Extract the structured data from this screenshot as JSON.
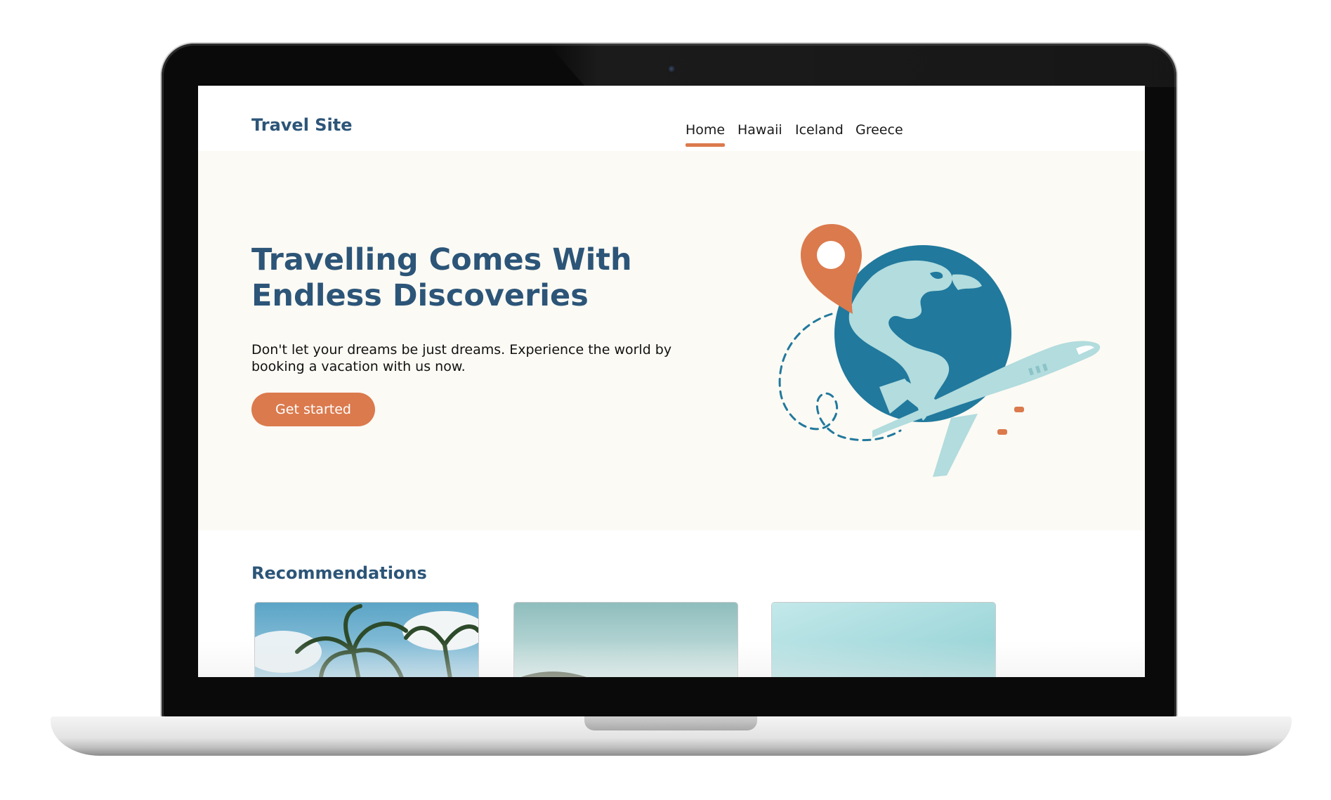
{
  "site": {
    "logo": "Travel Site"
  },
  "nav": {
    "items": [
      {
        "label": "Home",
        "active": true
      },
      {
        "label": "Hawaii",
        "active": false
      },
      {
        "label": "Iceland",
        "active": false
      },
      {
        "label": "Greece",
        "active": false
      }
    ]
  },
  "hero": {
    "headline_line1": "Travelling Comes With",
    "headline_line2": "Endless Discoveries",
    "subtitle_line1": "Don't let your dreams be just dreams. Experience the world by",
    "subtitle_line2": "booking a vacation with us now.",
    "cta_label": "Get started",
    "illustration_icons": [
      "map-pin-icon",
      "globe-icon",
      "airplane-icon",
      "dashed-flight-path"
    ]
  },
  "recommendations": {
    "title": "Recommendations",
    "cards": [
      {
        "image": "palm-trees-photo"
      },
      {
        "image": "coastline-photo"
      },
      {
        "image": "turquoise-water-photo"
      }
    ]
  },
  "colors": {
    "brand_blue": "#2c5578",
    "accent_orange": "#db7a4d",
    "hero_bg": "#fcfaf4",
    "globe_ocean": "#21799d",
    "globe_land": "#b2dcde"
  }
}
